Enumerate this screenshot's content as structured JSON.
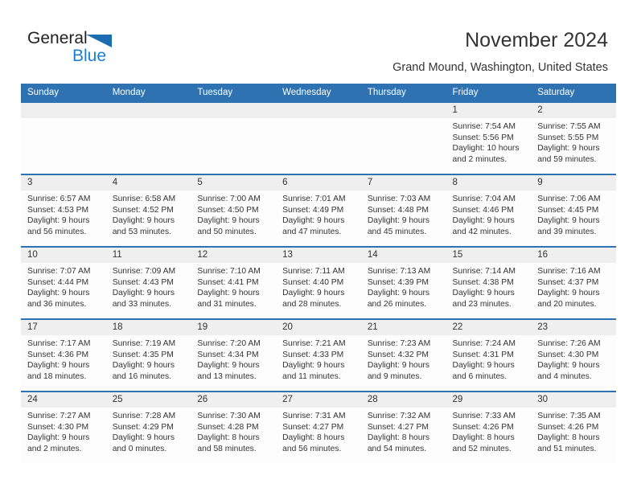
{
  "brand": {
    "name_part1": "General",
    "name_part2": "Blue",
    "accent_color": "#1b6cb0",
    "header_color": "#2e72b2"
  },
  "header": {
    "title": "November 2024",
    "subtitle": "Grand Mound, Washington, United States"
  },
  "calendar": {
    "weekday_headers": [
      "Sunday",
      "Monday",
      "Tuesday",
      "Wednesday",
      "Thursday",
      "Friday",
      "Saturday"
    ],
    "weeks": [
      [
        {
          "day": "",
          "lines": []
        },
        {
          "day": "",
          "lines": []
        },
        {
          "day": "",
          "lines": []
        },
        {
          "day": "",
          "lines": []
        },
        {
          "day": "",
          "lines": []
        },
        {
          "day": "1",
          "lines": [
            "Sunrise: 7:54 AM",
            "Sunset: 5:56 PM",
            "Daylight: 10 hours",
            "and 2 minutes."
          ]
        },
        {
          "day": "2",
          "lines": [
            "Sunrise: 7:55 AM",
            "Sunset: 5:55 PM",
            "Daylight: 9 hours",
            "and 59 minutes."
          ]
        }
      ],
      [
        {
          "day": "3",
          "lines": [
            "Sunrise: 6:57 AM",
            "Sunset: 4:53 PM",
            "Daylight: 9 hours",
            "and 56 minutes."
          ]
        },
        {
          "day": "4",
          "lines": [
            "Sunrise: 6:58 AM",
            "Sunset: 4:52 PM",
            "Daylight: 9 hours",
            "and 53 minutes."
          ]
        },
        {
          "day": "5",
          "lines": [
            "Sunrise: 7:00 AM",
            "Sunset: 4:50 PM",
            "Daylight: 9 hours",
            "and 50 minutes."
          ]
        },
        {
          "day": "6",
          "lines": [
            "Sunrise: 7:01 AM",
            "Sunset: 4:49 PM",
            "Daylight: 9 hours",
            "and 47 minutes."
          ]
        },
        {
          "day": "7",
          "lines": [
            "Sunrise: 7:03 AM",
            "Sunset: 4:48 PM",
            "Daylight: 9 hours",
            "and 45 minutes."
          ]
        },
        {
          "day": "8",
          "lines": [
            "Sunrise: 7:04 AM",
            "Sunset: 4:46 PM",
            "Daylight: 9 hours",
            "and 42 minutes."
          ]
        },
        {
          "day": "9",
          "lines": [
            "Sunrise: 7:06 AM",
            "Sunset: 4:45 PM",
            "Daylight: 9 hours",
            "and 39 minutes."
          ]
        }
      ],
      [
        {
          "day": "10",
          "lines": [
            "Sunrise: 7:07 AM",
            "Sunset: 4:44 PM",
            "Daylight: 9 hours",
            "and 36 minutes."
          ]
        },
        {
          "day": "11",
          "lines": [
            "Sunrise: 7:09 AM",
            "Sunset: 4:43 PM",
            "Daylight: 9 hours",
            "and 33 minutes."
          ]
        },
        {
          "day": "12",
          "lines": [
            "Sunrise: 7:10 AM",
            "Sunset: 4:41 PM",
            "Daylight: 9 hours",
            "and 31 minutes."
          ]
        },
        {
          "day": "13",
          "lines": [
            "Sunrise: 7:11 AM",
            "Sunset: 4:40 PM",
            "Daylight: 9 hours",
            "and 28 minutes."
          ]
        },
        {
          "day": "14",
          "lines": [
            "Sunrise: 7:13 AM",
            "Sunset: 4:39 PM",
            "Daylight: 9 hours",
            "and 26 minutes."
          ]
        },
        {
          "day": "15",
          "lines": [
            "Sunrise: 7:14 AM",
            "Sunset: 4:38 PM",
            "Daylight: 9 hours",
            "and 23 minutes."
          ]
        },
        {
          "day": "16",
          "lines": [
            "Sunrise: 7:16 AM",
            "Sunset: 4:37 PM",
            "Daylight: 9 hours",
            "and 20 minutes."
          ]
        }
      ],
      [
        {
          "day": "17",
          "lines": [
            "Sunrise: 7:17 AM",
            "Sunset: 4:36 PM",
            "Daylight: 9 hours",
            "and 18 minutes."
          ]
        },
        {
          "day": "18",
          "lines": [
            "Sunrise: 7:19 AM",
            "Sunset: 4:35 PM",
            "Daylight: 9 hours",
            "and 16 minutes."
          ]
        },
        {
          "day": "19",
          "lines": [
            "Sunrise: 7:20 AM",
            "Sunset: 4:34 PM",
            "Daylight: 9 hours",
            "and 13 minutes."
          ]
        },
        {
          "day": "20",
          "lines": [
            "Sunrise: 7:21 AM",
            "Sunset: 4:33 PM",
            "Daylight: 9 hours",
            "and 11 minutes."
          ]
        },
        {
          "day": "21",
          "lines": [
            "Sunrise: 7:23 AM",
            "Sunset: 4:32 PM",
            "Daylight: 9 hours",
            "and 9 minutes."
          ]
        },
        {
          "day": "22",
          "lines": [
            "Sunrise: 7:24 AM",
            "Sunset: 4:31 PM",
            "Daylight: 9 hours",
            "and 6 minutes."
          ]
        },
        {
          "day": "23",
          "lines": [
            "Sunrise: 7:26 AM",
            "Sunset: 4:30 PM",
            "Daylight: 9 hours",
            "and 4 minutes."
          ]
        }
      ],
      [
        {
          "day": "24",
          "lines": [
            "Sunrise: 7:27 AM",
            "Sunset: 4:30 PM",
            "Daylight: 9 hours",
            "and 2 minutes."
          ]
        },
        {
          "day": "25",
          "lines": [
            "Sunrise: 7:28 AM",
            "Sunset: 4:29 PM",
            "Daylight: 9 hours",
            "and 0 minutes."
          ]
        },
        {
          "day": "26",
          "lines": [
            "Sunrise: 7:30 AM",
            "Sunset: 4:28 PM",
            "Daylight: 8 hours",
            "and 58 minutes."
          ]
        },
        {
          "day": "27",
          "lines": [
            "Sunrise: 7:31 AM",
            "Sunset: 4:27 PM",
            "Daylight: 8 hours",
            "and 56 minutes."
          ]
        },
        {
          "day": "28",
          "lines": [
            "Sunrise: 7:32 AM",
            "Sunset: 4:27 PM",
            "Daylight: 8 hours",
            "and 54 minutes."
          ]
        },
        {
          "day": "29",
          "lines": [
            "Sunrise: 7:33 AM",
            "Sunset: 4:26 PM",
            "Daylight: 8 hours",
            "and 52 minutes."
          ]
        },
        {
          "day": "30",
          "lines": [
            "Sunrise: 7:35 AM",
            "Sunset: 4:26 PM",
            "Daylight: 8 hours",
            "and 51 minutes."
          ]
        }
      ]
    ]
  }
}
